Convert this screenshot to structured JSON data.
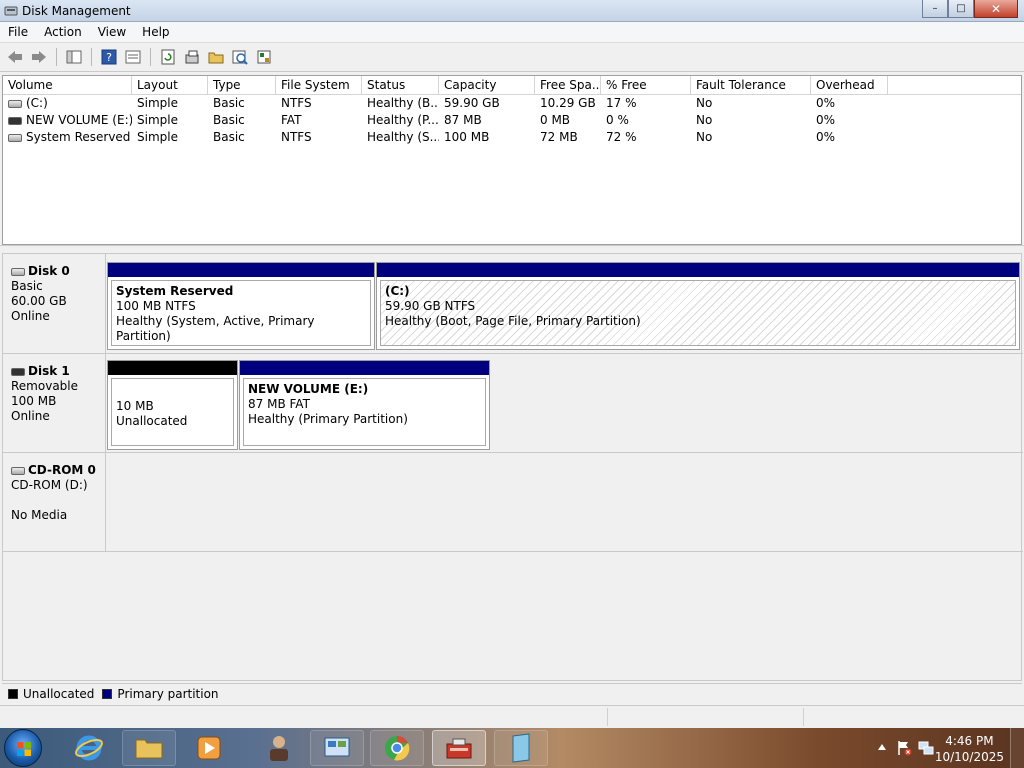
{
  "window": {
    "title": "Disk Management",
    "controls": {
      "minimize": "–",
      "maximize": "□",
      "close": "✕"
    }
  },
  "menu": [
    "File",
    "Action",
    "View",
    "Help"
  ],
  "toolbar": {
    "icons": [
      "back-icon",
      "forward-icon",
      "show-hide-console-tree-icon",
      "help-icon",
      "properties-icon",
      "refresh-icon",
      "rescan-disks-icon",
      "open-icon",
      "explore-icon",
      "settings-icon"
    ]
  },
  "volumes": {
    "columns": [
      "Volume",
      "Layout",
      "Type",
      "File System",
      "Status",
      "Capacity",
      "Free Spa...",
      "% Free",
      "Fault Tolerance",
      "Overhead"
    ],
    "rows": [
      {
        "volume": "(C:)",
        "layout": "Simple",
        "type": "Basic",
        "fs": "NTFS",
        "status": "Healthy (B...",
        "capacity": "59.90 GB",
        "free": "10.29 GB",
        "pct": "17 %",
        "fault": "No",
        "overhead": "0%",
        "icon": "fixed"
      },
      {
        "volume": "NEW VOLUME (E:)",
        "layout": "Simple",
        "type": "Basic",
        "fs": "FAT",
        "status": "Healthy (P...",
        "capacity": "87 MB",
        "free": "0 MB",
        "pct": "0 %",
        "fault": "No",
        "overhead": "0%",
        "icon": "removable"
      },
      {
        "volume": "System Reserved",
        "layout": "Simple",
        "type": "Basic",
        "fs": "NTFS",
        "status": "Healthy (S...",
        "capacity": "100 MB",
        "free": "72 MB",
        "pct": "72 %",
        "fault": "No",
        "overhead": "0%",
        "icon": "fixed"
      }
    ]
  },
  "disks": {
    "disk0": {
      "name": "Disk 0",
      "type": "Basic",
      "size": "60.00 GB",
      "state": "Online",
      "p1": {
        "title": "System Reserved",
        "size": "100 MB NTFS",
        "status": "Healthy (System, Active, Primary Partition)"
      },
      "p2": {
        "title": "(C:)",
        "size": "59.90 GB NTFS",
        "status": "Healthy (Boot, Page File, Primary Partition)"
      }
    },
    "disk1": {
      "name": "Disk 1",
      "type": "Removable",
      "size": "100 MB",
      "state": "Online",
      "p1": {
        "size": "10 MB",
        "status": "Unallocated"
      },
      "p2": {
        "title": "NEW VOLUME  (E:)",
        "size": "87 MB FAT",
        "status": "Healthy (Primary Partition)"
      }
    },
    "cdrom0": {
      "name": "CD-ROM 0",
      "drive": "CD-ROM (D:)",
      "media": "No Media"
    }
  },
  "legend": {
    "unallocated": "Unallocated",
    "primary": "Primary partition"
  },
  "colors": {
    "primary": "#00007f",
    "unallocated": "#000000"
  },
  "taskbar": {
    "time": "4:46 PM",
    "date": "10/10/2025"
  }
}
